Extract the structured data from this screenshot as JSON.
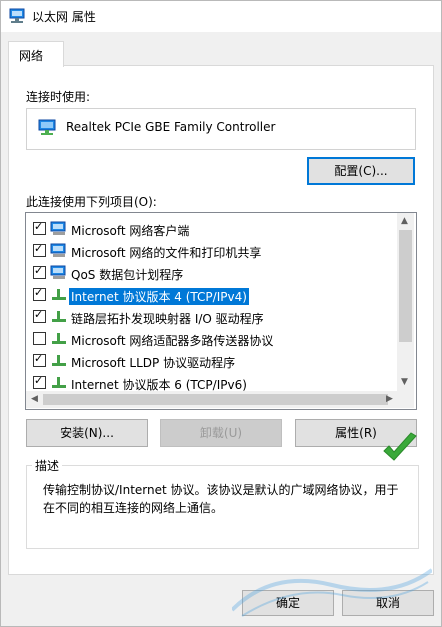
{
  "window": {
    "title": "以太网 属性"
  },
  "tabs": [
    {
      "label": "网络"
    }
  ],
  "connect_using": {
    "label": "连接时使用:",
    "adapter_name": "Realtek PCIe GBE Family Controller",
    "configure_button": "配置(C)..."
  },
  "items_section": {
    "label": "此连接使用下列项目(O):",
    "items": [
      {
        "label": "Microsoft 网络客户端",
        "checked": true,
        "icon": "network-client-icon"
      },
      {
        "label": "Microsoft 网络的文件和打印机共享",
        "checked": true,
        "icon": "file-share-icon"
      },
      {
        "label": "QoS 数据包计划程序",
        "checked": true,
        "icon": "protocol-icon"
      },
      {
        "label": "Internet 协议版本 4 (TCP/IPv4)",
        "checked": true,
        "selected": true,
        "icon": "protocol-icon"
      },
      {
        "label": "链路层拓扑发现映射器 I/O 驱动程序",
        "checked": true,
        "icon": "protocol-icon"
      },
      {
        "label": "Microsoft 网络适配器多路传送器协议",
        "checked": false,
        "icon": "protocol-icon"
      },
      {
        "label": "Microsoft LLDP 协议驱动程序",
        "checked": true,
        "icon": "protocol-icon"
      },
      {
        "label": "Internet 协议版本 6 (TCP/IPv6)",
        "checked": true,
        "icon": "protocol-icon"
      }
    ]
  },
  "buttons": {
    "install": "安装(N)...",
    "uninstall": "卸载(U)",
    "properties": "属性(R)",
    "ok": "确定",
    "cancel": "取消"
  },
  "description": {
    "title": "描述",
    "text": "传输控制协议/Internet 协议。该协议是默认的广域网络协议，用于在不同的相互连接的网络上通信。"
  },
  "colors": {
    "accent": "#0078d7",
    "selection": "#0078d7",
    "check_green": "#3aa93a"
  }
}
